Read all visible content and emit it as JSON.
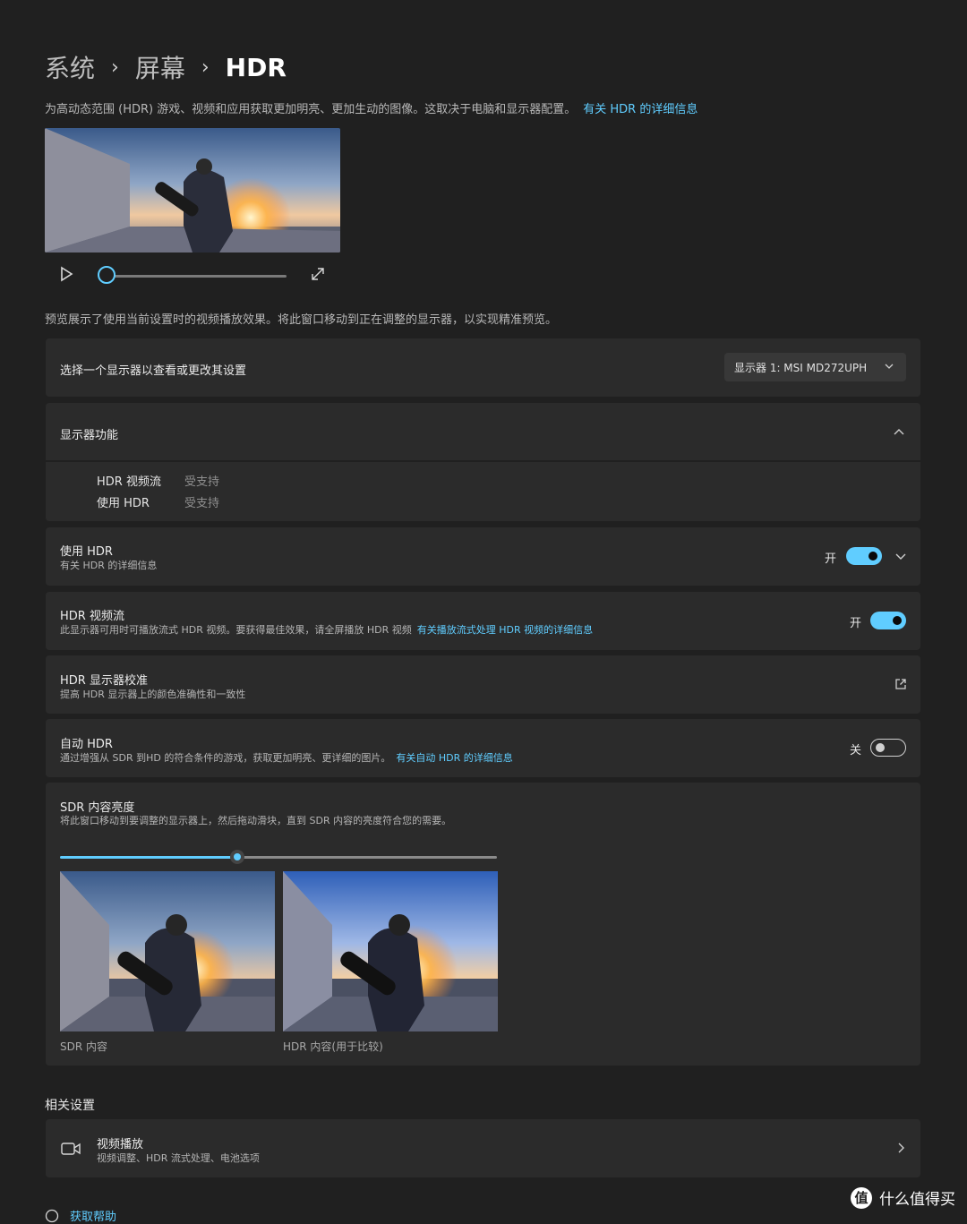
{
  "breadcrumb": {
    "items": [
      "系统",
      "屏幕",
      "HDR"
    ]
  },
  "intro": {
    "text": "为高动态范围 (HDR) 游戏、视频和应用获取更加明亮、更加生动的图像。这取决于电脑和显示器配置。",
    "link": "有关 HDR 的详细信息"
  },
  "preview": {
    "note": "预览展示了使用当前设置时的视频播放效果。将此窗口移动到正在调整的显示器，以实现精准预览。",
    "progress": 0
  },
  "display_select": {
    "label": "选择一个显示器以查看或更改其设置",
    "value": "显示器 1: MSI MD272UPH"
  },
  "capabilities": {
    "title": "显示器功能",
    "rows": [
      {
        "name": "HDR 视频流",
        "value": "受支持"
      },
      {
        "name": "使用 HDR",
        "value": "受支持"
      }
    ]
  },
  "use_hdr": {
    "title": "使用 HDR",
    "link": "有关 HDR 的详细信息",
    "state": "开",
    "on": true
  },
  "hdr_streaming": {
    "title": "HDR 视频流",
    "desc": "此显示器可用时可播放流式 HDR 视频。要获得最佳效果，请全屏播放 HDR 视频",
    "link": "有关播放流式处理 HDR 视频的详细信息",
    "state": "开",
    "on": true
  },
  "calibration": {
    "title": "HDR 显示器校准",
    "desc": "提高 HDR 显示器上的颜色准确性和一致性"
  },
  "auto_hdr": {
    "title": "自动 HDR",
    "desc": "通过增强从 SDR 到HD 的符合条件的游戏，获取更加明亮、更详细的图片。",
    "link": "有关自动 HDR 的详细信息",
    "state": "关",
    "on": false
  },
  "sdr_brightness": {
    "title": "SDR 内容亮度",
    "desc": "将此窗口移动到要调整的显示器上，然后拖动滑块，直到 SDR 内容的亮度符合您的需要。",
    "slider_fraction": 0.4,
    "captions": [
      "SDR 内容",
      "HDR 内容(用于比较)"
    ]
  },
  "related": {
    "heading": "相关设置",
    "video": {
      "title": "视频播放",
      "desc": "视频调整、HDR 流式处理、电池选项"
    }
  },
  "help": {
    "label": "获取帮助"
  },
  "watermark": {
    "logo": "值",
    "text": "什么值得买"
  },
  "colors": {
    "accent": "#60cdff",
    "background": "#202020",
    "card": "#2b2b2b"
  }
}
